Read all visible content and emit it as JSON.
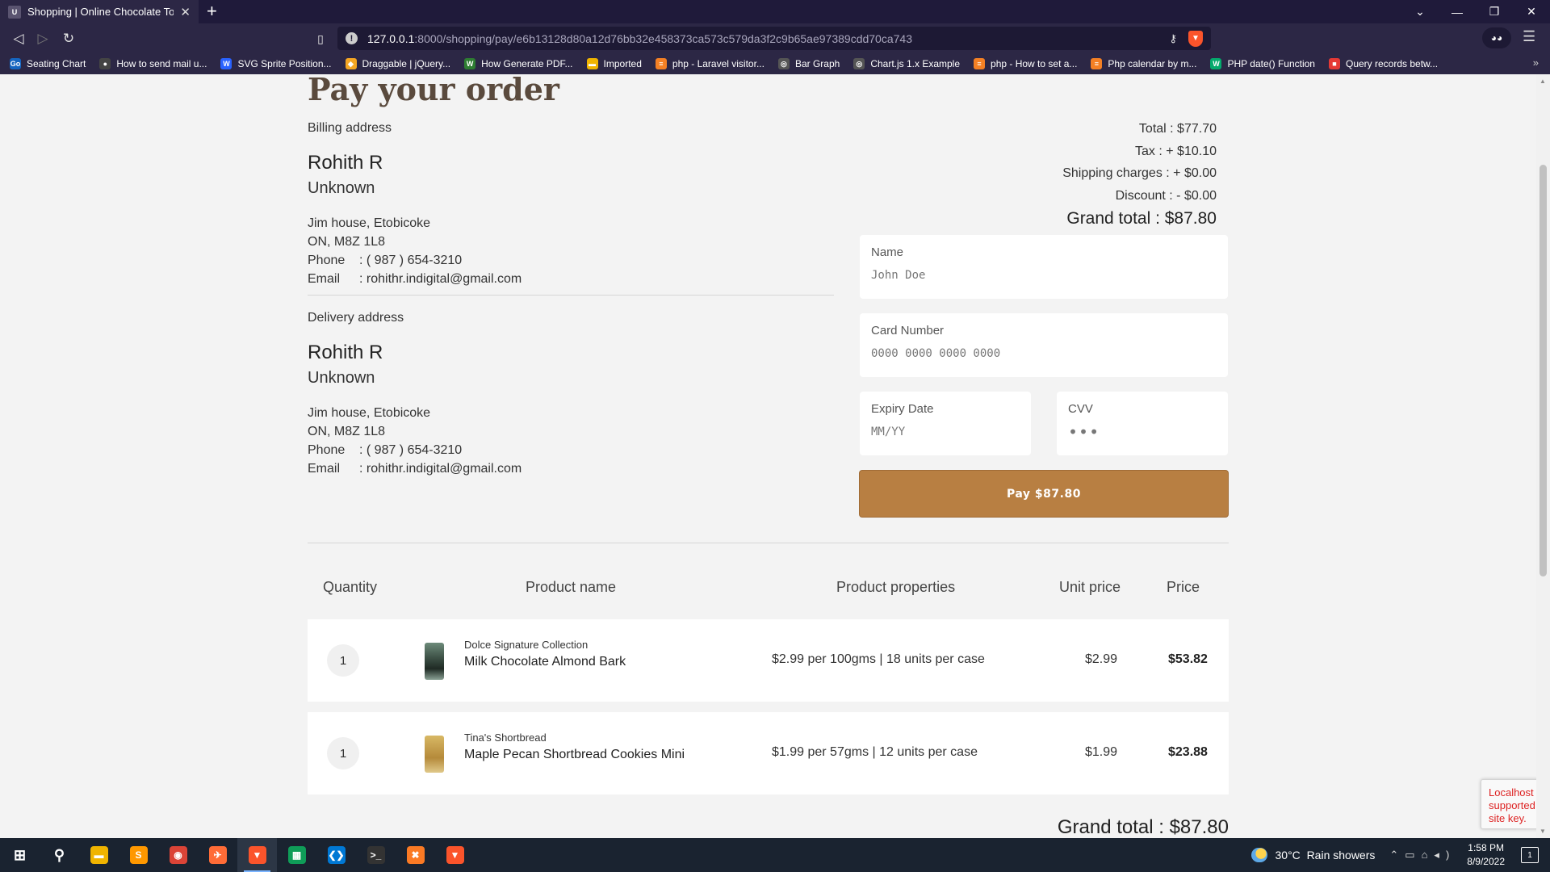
{
  "browser": {
    "tab_favicon": "U",
    "tab_title": "Shopping | Online Chocolate Toro",
    "url_host": "127.0.0.1",
    "url_path": ":8000/shopping/pay/e6b13128d80a12d76bb32e458373ca573c579da3f2c9b65ae97389cdd70ca743",
    "bookmarks": [
      {
        "label": "Seating Chart",
        "icon": "Go",
        "color": "#1565c0"
      },
      {
        "label": "How to send mail u...",
        "icon": "●",
        "color": "#444444"
      },
      {
        "label": "SVG Sprite Position...",
        "icon": "W",
        "color": "#2962ff"
      },
      {
        "label": "Draggable | jQuery...",
        "icon": "◆",
        "color": "#f5a623"
      },
      {
        "label": "How Generate PDF...",
        "icon": "W",
        "color": "#2e7d32"
      },
      {
        "label": "Imported",
        "icon": "▬",
        "color": "#f0b400"
      },
      {
        "label": "php - Laravel visitor...",
        "icon": "≡",
        "color": "#f48024"
      },
      {
        "label": "Bar Graph",
        "icon": "◎",
        "color": "#555555"
      },
      {
        "label": "Chart.js 1.x Example",
        "icon": "◎",
        "color": "#555555"
      },
      {
        "label": "php - How to set a...",
        "icon": "≡",
        "color": "#f48024"
      },
      {
        "label": "Php calendar by m...",
        "icon": "≡",
        "color": "#f48024"
      },
      {
        "label": "PHP date() Function",
        "icon": "W",
        "color": "#04aa6d"
      },
      {
        "label": "Query records betw...",
        "icon": "■",
        "color": "#e53935"
      }
    ]
  },
  "page": {
    "title": "Pay your order",
    "billing": {
      "label": "Billing address",
      "name": "Rohith R",
      "company": "Unknown",
      "line1": "Jim house, Etobicoke",
      "line2": "ON, M8Z 1L8",
      "phone_label": "Phone",
      "phone": ": ( 987 ) 654-3210",
      "email_label": "Email",
      "email": ": rohithr.indigital@gmail.com"
    },
    "delivery": {
      "label": "Delivery address",
      "name": "Rohith R",
      "company": "Unknown",
      "line1": "Jim house, Etobicoke",
      "line2": "ON, M8Z 1L8",
      "phone_label": "Phone",
      "phone": ": ( 987 ) 654-3210",
      "email_label": "Email",
      "email": ": rohithr.indigital@gmail.com"
    },
    "totals": {
      "total": "Total : $77.70",
      "tax": "Tax : + $10.10",
      "shipping": "Shipping charges : + $0.00",
      "discount": "Discount : - $0.00",
      "grand": "Grand total : $87.80"
    },
    "form": {
      "name_label": "Name",
      "name_placeholder": "John Doe",
      "card_label": "Card Number",
      "card_placeholder": "0000 0000 0000 0000",
      "expiry_label": "Expiry Date",
      "expiry_placeholder": "MM/YY",
      "cvv_label": "CVV",
      "cvv_placeholder": "•••",
      "pay_button": "Pay $87.80"
    },
    "table": {
      "headers": {
        "quantity": "Quantity",
        "product_name": "Product name",
        "properties": "Product properties",
        "unit_price": "Unit price",
        "price": "Price"
      },
      "rows": [
        {
          "qty": "1",
          "brand": "Dolce Signature Collection",
          "name": "Milk Chocolate Almond Bark",
          "properties": "$2.99 per 100gms | 18 units per case",
          "unit_price": "$2.99",
          "price": "$53.82"
        },
        {
          "qty": "1",
          "brand": "Tina's Shortbread",
          "name": "Maple Pecan Shortbread Cookies Mini",
          "properties": "$1.99 per 57gms | 12 units per case",
          "unit_price": "$1.99",
          "price": "$23.88"
        }
      ]
    },
    "grand_total_bottom": "Grand total : $87.80",
    "recaptcha_text_1": "Localhost",
    "recaptcha_text_2": "supported",
    "recaptcha_text_3": "site key."
  },
  "taskbar": {
    "weather_temp": "30°C",
    "weather_desc": "Rain showers",
    "time": "1:58 PM",
    "date": "8/9/2022",
    "notifications": "1",
    "apps": [
      {
        "name": "start-icon",
        "glyph": "⊞",
        "color": "transparent"
      },
      {
        "name": "search-icon",
        "glyph": "⚲",
        "color": "transparent"
      },
      {
        "name": "file-explorer-icon",
        "glyph": "▬",
        "color": "#f0b400"
      },
      {
        "name": "sublime-text-icon",
        "glyph": "S",
        "color": "#ff9800"
      },
      {
        "name": "chrome-icon",
        "glyph": "◉",
        "color": "#db4437"
      },
      {
        "name": "postman-icon",
        "glyph": "✈",
        "color": "#ff6c37"
      },
      {
        "name": "brave-icon",
        "glyph": "▼",
        "color": "#fb542b"
      },
      {
        "name": "spreadsheet-icon",
        "glyph": "▦",
        "color": "#0f9d58"
      },
      {
        "name": "vscode-icon",
        "glyph": "❮❯",
        "color": "#0078d4"
      },
      {
        "name": "terminal-icon",
        "glyph": ">_",
        "color": "#333333"
      },
      {
        "name": "xampp-icon",
        "glyph": "✖",
        "color": "#fb7a24"
      },
      {
        "name": "brave-alt-icon",
        "glyph": "▼",
        "color": "#fb542b"
      }
    ]
  }
}
